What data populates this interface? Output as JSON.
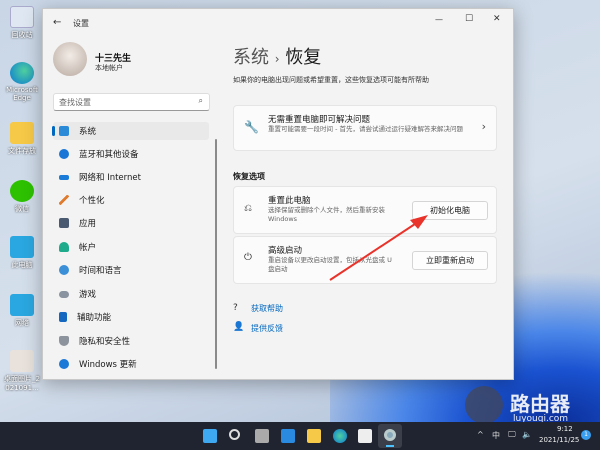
{
  "desktop": {
    "icons": [
      {
        "label": "回收站"
      },
      {
        "label": "Microsoft Edge"
      },
      {
        "label": "文件存放"
      },
      {
        "label": "微信"
      },
      {
        "label": "此电脑"
      },
      {
        "label": "网络"
      },
      {
        "label": "桌面图片_2021091..."
      }
    ]
  },
  "window": {
    "title": "设置",
    "controls": {
      "minimize": "—",
      "maximize": "☐",
      "close": "✕"
    }
  },
  "user": {
    "name": "十三先生",
    "account_type": "本地帐户"
  },
  "search": {
    "placeholder": "查找设置"
  },
  "sidebar": {
    "items": [
      {
        "label": "系统",
        "selected": true
      },
      {
        "label": "蓝牙和其他设备"
      },
      {
        "label": "网络和 Internet"
      },
      {
        "label": "个性化"
      },
      {
        "label": "应用"
      },
      {
        "label": "帐户"
      },
      {
        "label": "时间和语言"
      },
      {
        "label": "游戏"
      },
      {
        "label": "辅助功能"
      },
      {
        "label": "隐私和安全性"
      },
      {
        "label": "Windows 更新"
      }
    ]
  },
  "main": {
    "breadcrumb_parent": "系统",
    "breadcrumb_sep": "›",
    "title": "恢复",
    "description": "如果你的电脑出现问题或希望重置，这些恢复选项可能有所帮助",
    "fix": {
      "title": "无需重置电脑即可解决问题",
      "desc": "重置可能需要一段时间 - 首先，请尝试通过运行疑难解答来解决问题"
    },
    "section_label": "恢复选项",
    "reset": {
      "title": "重置此电脑",
      "desc": "选择保留或删除个人文件，然后重新安装 Windows",
      "button": "初始化电脑"
    },
    "advanced": {
      "title": "高级启动",
      "desc": "重启设备以更改启动设置，包括从光盘或 U 盘启动",
      "button": "立即重新启动"
    },
    "links": {
      "help": "获取帮助",
      "feedback": "提供反馈"
    }
  },
  "watermark": {
    "name": "路由器",
    "url": "luyouqi.com"
  },
  "taskbar": {
    "tray": {
      "chevron": "^",
      "ime": "中",
      "time": "9:12",
      "date": "2021/11/25",
      "badge": "1"
    }
  },
  "colors": {
    "accent": "#0067c0",
    "arrow": "#e8322a"
  }
}
